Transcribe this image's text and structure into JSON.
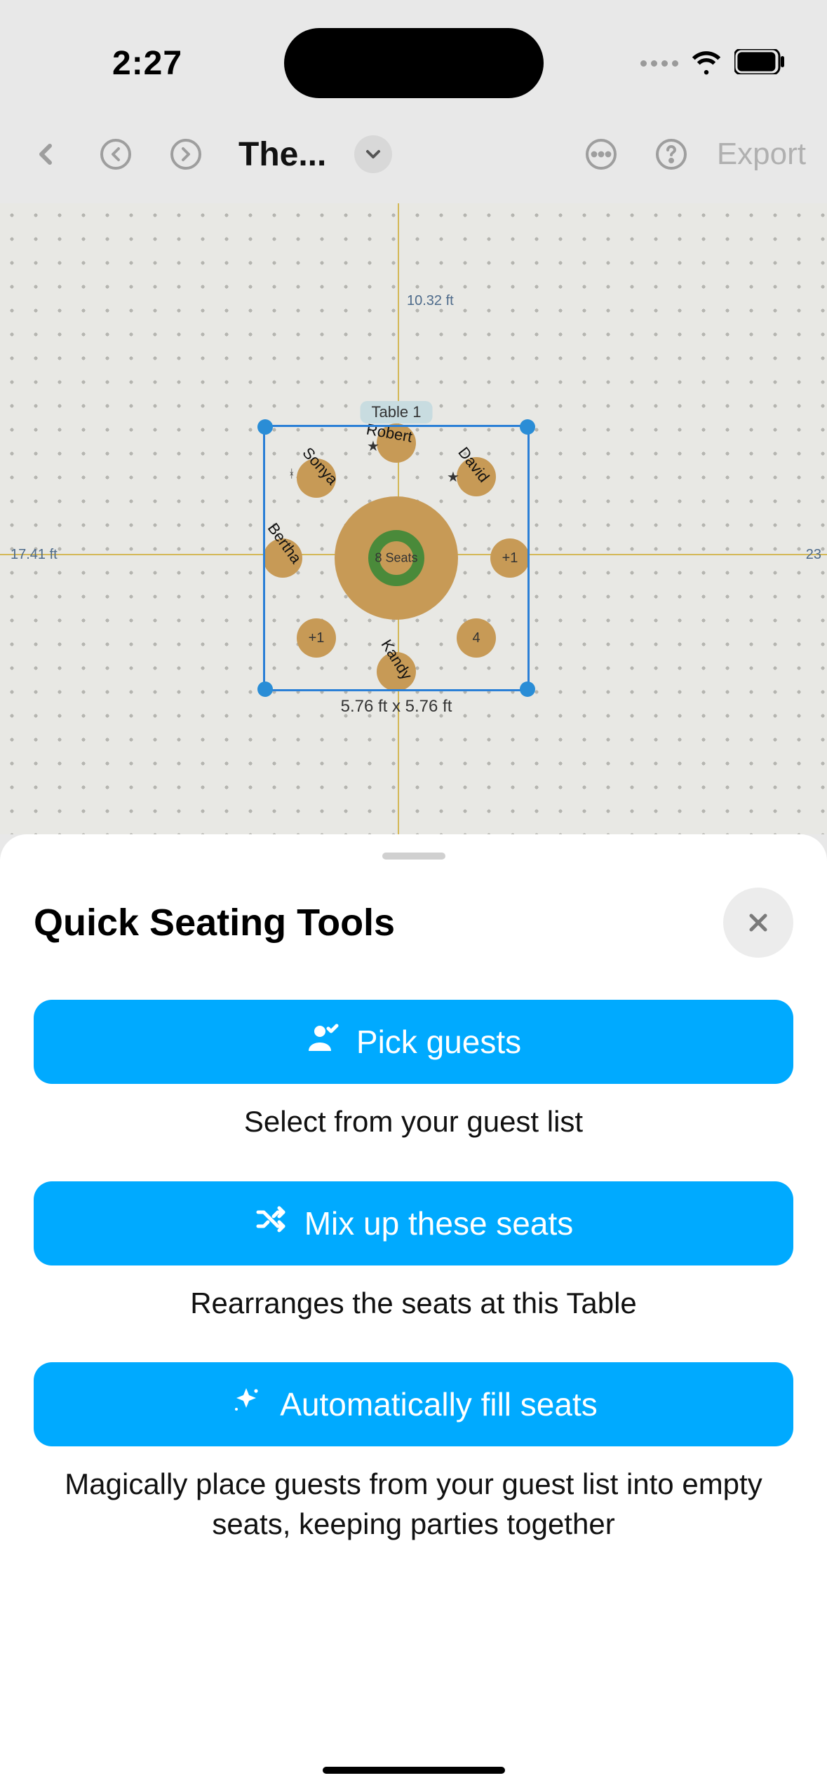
{
  "status": {
    "time": "2:27"
  },
  "toolbar": {
    "title": "The...",
    "export": "Export"
  },
  "canvas": {
    "axis_v_label": "10.32 ft",
    "axis_h_label": "17.41 ft",
    "axis_h_right": "23",
    "table": {
      "label": "Table 1",
      "seats_text": "8 Seats",
      "dims": "5.76 ft x 5.76 ft",
      "seats": {
        "robert": "Robert",
        "david": "David",
        "plus1a": "+1",
        "four": "4",
        "kandy": "Kandy",
        "plus1b": "+1",
        "bertha": "Bertha",
        "sonya": "Sonya"
      }
    }
  },
  "sheet": {
    "title": "Quick Seating Tools",
    "pick": {
      "label": "Pick guests",
      "desc": "Select from your guest list"
    },
    "mix": {
      "label": "Mix up these seats",
      "desc": "Rearranges the seats at this Table"
    },
    "auto": {
      "label": "Automatically fill seats",
      "desc": "Magically place guests from your guest list into empty seats, keeping parties together"
    }
  }
}
